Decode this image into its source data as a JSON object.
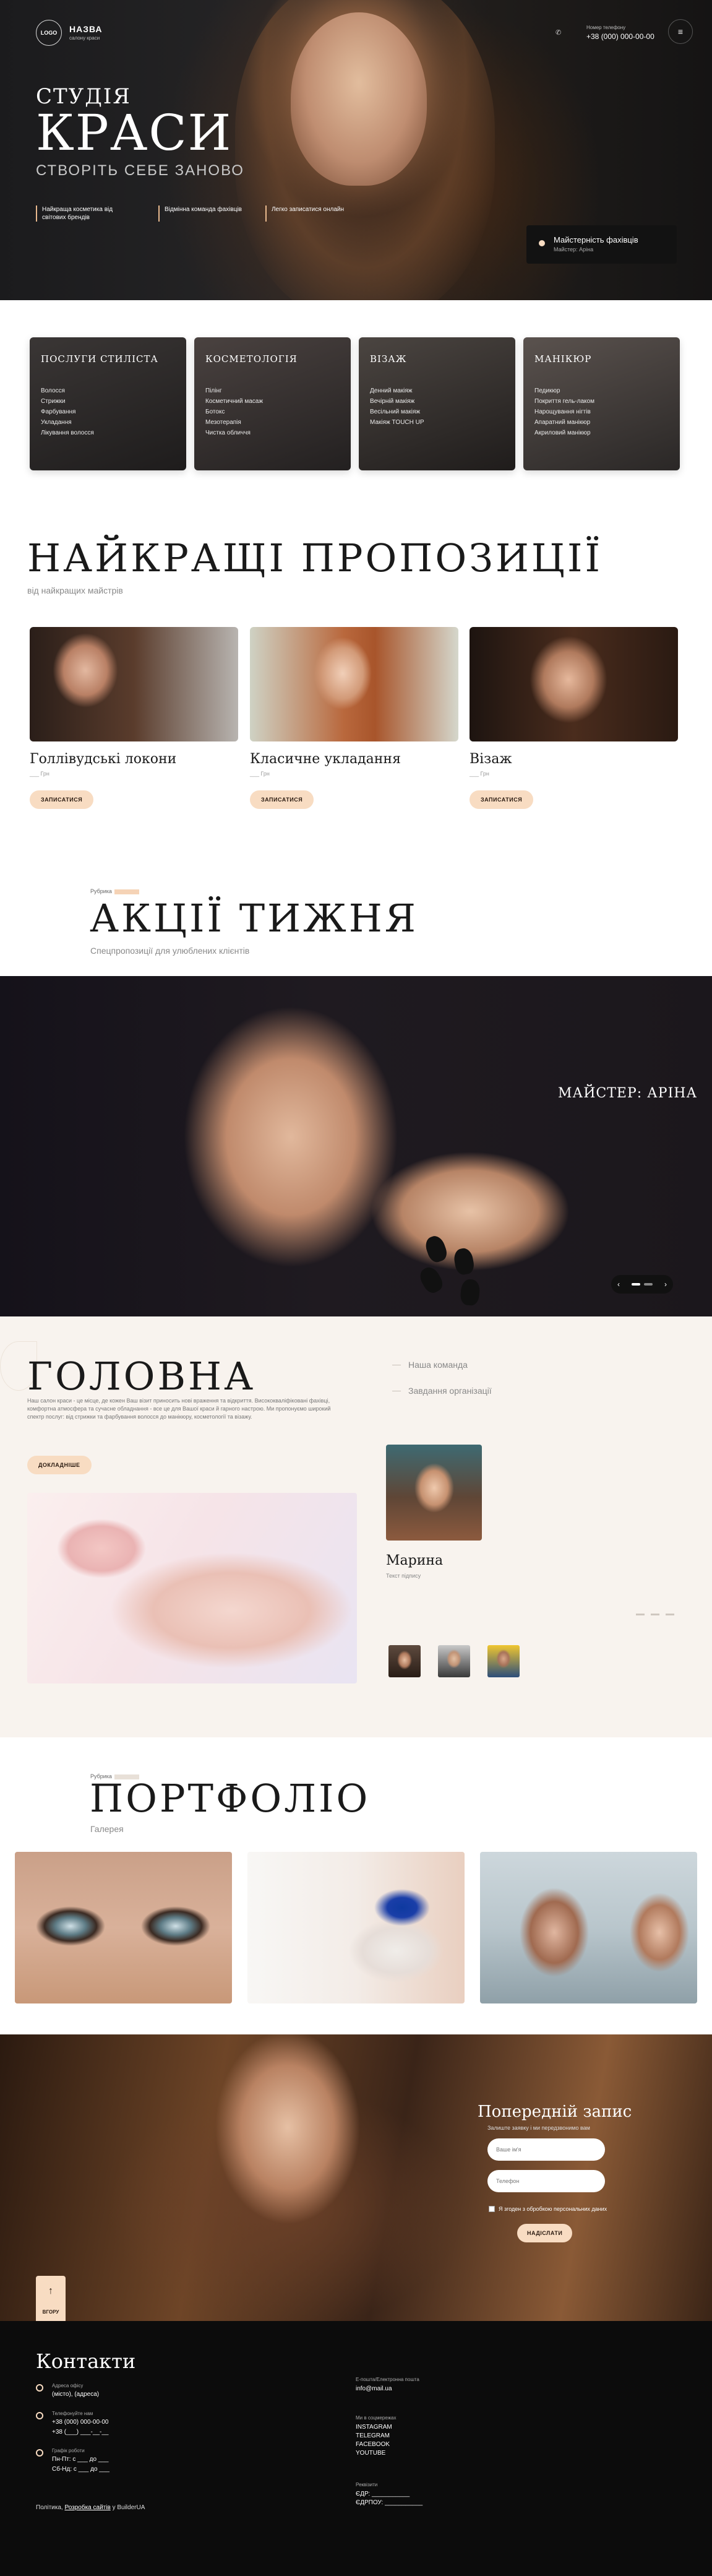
{
  "header": {
    "logo": "LOGO",
    "brand_name": "НАЗВА",
    "brand_sub": "салону краси",
    "phone_label": "Номер телефону",
    "phone": "+38 (000) 000-00-00",
    "menu_icon": "menu-icon"
  },
  "hero": {
    "title_1": "СТУДІЯ",
    "title_2": "КРАСИ",
    "subtitle": "СТВОРІТЬ СЕБЕ ЗАНОВО",
    "features": [
      "Найкраща косметика від світових брендів",
      "Відмінна команда фахівців",
      "Легко записатися онлайн"
    ],
    "master_card_title": "Майстерність фахівців",
    "master_card_sub": "Майстер: Аріна"
  },
  "services": [
    {
      "title": "ПОСЛУГИ СТИЛІСТА",
      "items": [
        "Волосся",
        "Стрижки",
        "Фарбування",
        "Укладання",
        "Лікування волосся"
      ]
    },
    {
      "title": "КОСМЕТОЛОГІЯ",
      "items": [
        "Пілінг",
        "Косметичний масаж",
        "Ботокс",
        "Мезотерапія",
        "Чистка обличчя"
      ]
    },
    {
      "title": "ВІЗАЖ",
      "items": [
        "Денний макіяж",
        "Вечірній макіяж",
        "Весільний макіяж",
        "Макіяж TOUCH UP"
      ]
    },
    {
      "title": "МАНІКЮР",
      "items": [
        "Педикюр",
        "Покриття гель-лаком",
        "Нарощування нігтів",
        "Апаратний манікюр",
        "Акриловий манікюр"
      ]
    }
  ],
  "offers": {
    "title": "НАЙКРАЩІ ПРОПОЗИЦІЇ",
    "subtitle": "від найкращих майстрів",
    "items": [
      {
        "title": "Голлівудські локони",
        "price": "___ Грн",
        "button": "ЗАПИСАТИСЯ"
      },
      {
        "title": "Класичне укладання",
        "price": "___ Грн",
        "button": "ЗАПИСАТИСЯ"
      },
      {
        "title": "Візаж",
        "price": "___ Грн",
        "button": "ЗАПИСАТИСЯ"
      }
    ]
  },
  "promo": {
    "tag": "Рубрика",
    "title": "АКЦІЇ ТИЖНЯ",
    "subtitle": "Спецпропозиції для улюблених клієнтів",
    "master": "МАЙСТЕР: АРІНА",
    "prev": "‹",
    "next": "›"
  },
  "main": {
    "title": "ГОЛОВНА",
    "description": "Наш салон краси - це місце, де кожен Ваш візит приносить нові враження та відкриття. Висококваліфіковані фахівці, комфортна атмосфера та сучасне обладнання - все це для Вашої краси й гарного настрою. Ми пропонуємо широкий спектр послуг: від стрижки та фарбування волосся до манікюру, косметології та візажу.",
    "button": "ДОКЛАДНІШЕ",
    "tabs": [
      "Наша команда",
      "Завдання організації"
    ],
    "member_name": "Марина",
    "member_text": "Текст підпису"
  },
  "portfolio": {
    "tag": "Рубрика",
    "title": "ПОРТФОЛІО",
    "subtitle": "Галерея"
  },
  "booking": {
    "title": "Попередній запис",
    "sub": "Залиште заявку і ми передзвонимо вам",
    "name_placeholder": "Ваше ім'я",
    "phone_placeholder": "Телефон",
    "agree": "Я згоден з обробкою персональних даних",
    "button": "НАДІСЛАТИ",
    "up_label": "ВГОРУ",
    "up_arrow": "↑"
  },
  "contacts": {
    "title": "Контакти",
    "address_label": "Адреса офісу",
    "address": "(місто), (адреса)",
    "phone_label": "Телефонуйте нам",
    "phone_1": "+38 (000) 000-00-00",
    "phone_2": "+38 (___) ___-__-__",
    "hours_label": "Графік роботи",
    "hours_1": "Пн-Пт: с ___ до ___",
    "hours_2": "Сб-Нд: с ___ до ___",
    "email_label": "Е-пошта/Електронна пошта",
    "email": "info@mail.ua",
    "social_label": "Ми в соцмережах",
    "socials": [
      "INSTAGRAM",
      "TELEGRAM",
      "FACEBOOK",
      "YOUTUBE"
    ],
    "req_label": "Реквізити",
    "req_1": "ЄДР: ___________",
    "req_2": "ЄДРПОУ: ___________",
    "policy_prefix": "Політика,",
    "policy_link": "Розробка сайтів",
    "policy_suffix": "у BuilderUA"
  }
}
